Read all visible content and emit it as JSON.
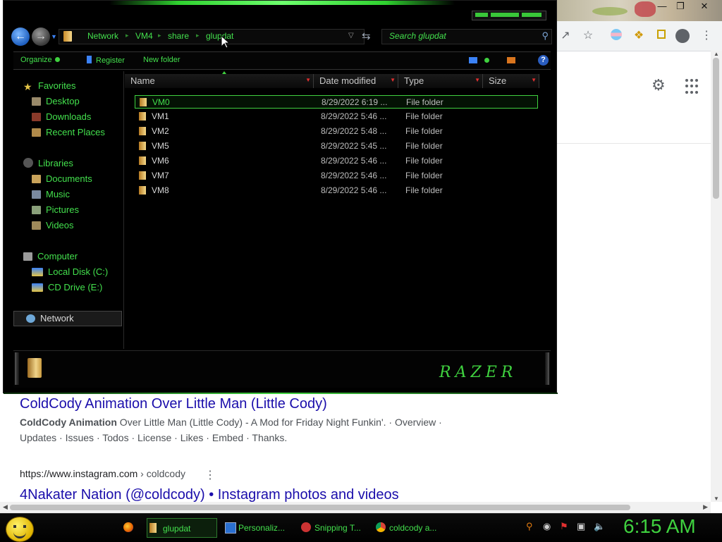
{
  "explorer": {
    "breadcrumb": [
      "Network",
      "VM4",
      "share",
      "glupdat"
    ],
    "search_placeholder": "Search glupdat",
    "commands": {
      "organize": "Organize",
      "register": "Register",
      "new_folder": "New folder"
    },
    "nav": {
      "favorites": "Favorites",
      "desktop": "Desktop",
      "downloads": "Downloads",
      "recent_places": "Recent Places",
      "libraries": "Libraries",
      "documents": "Documents",
      "music": "Music",
      "pictures": "Pictures",
      "videos": "Videos",
      "computer": "Computer",
      "local_disk": "Local Disk (C:)",
      "cd_drive": "CD Drive (E:)",
      "network": "Network"
    },
    "columns": {
      "name": "Name",
      "date_modified": "Date modified",
      "type": "Type",
      "size": "Size"
    },
    "files": [
      {
        "name": "VM0",
        "date": "8/29/2022 6:19 ...",
        "type": "File folder"
      },
      {
        "name": "VM1",
        "date": "8/29/2022 5:46 ...",
        "type": "File folder"
      },
      {
        "name": "VM2",
        "date": "8/29/2022 5:48 ...",
        "type": "File folder"
      },
      {
        "name": "VM5",
        "date": "8/29/2022 5:45 ...",
        "type": "File folder"
      },
      {
        "name": "VM6",
        "date": "8/29/2022 5:46 ...",
        "type": "File folder"
      },
      {
        "name": "VM7",
        "date": "8/29/2022 5:46 ...",
        "type": "File folder"
      },
      {
        "name": "VM8",
        "date": "8/29/2022 5:46 ...",
        "type": "File folder"
      }
    ],
    "brand_logo": "RAZER",
    "theme_color": "#3fd13f"
  },
  "browser": {
    "results": [
      {
        "title": "ColdCody Animation Over Little Man (Little Cody)",
        "snippet_bold": "ColdCody Animation",
        "snippet_line1": " Over Little Man (Little Cody) - A Mod for Friday Night Funkin'. · Overview ·",
        "snippet_line2": "Updates · Issues · Todos · License · Likes · Embed · Thanks."
      },
      {
        "url_host": "https://www.instagram.com",
        "url_path": " › coldcody",
        "title": "4Nakater Nation (@coldcody) • Instagram photos and videos"
      }
    ],
    "link_color": "#1a0dab"
  },
  "taskbar": {
    "items": [
      {
        "label": "glupdat"
      },
      {
        "label": "Personaliz..."
      },
      {
        "label": "Snipping T..."
      },
      {
        "label": "coldcody a..."
      }
    ],
    "clock": "6:15 AM"
  }
}
